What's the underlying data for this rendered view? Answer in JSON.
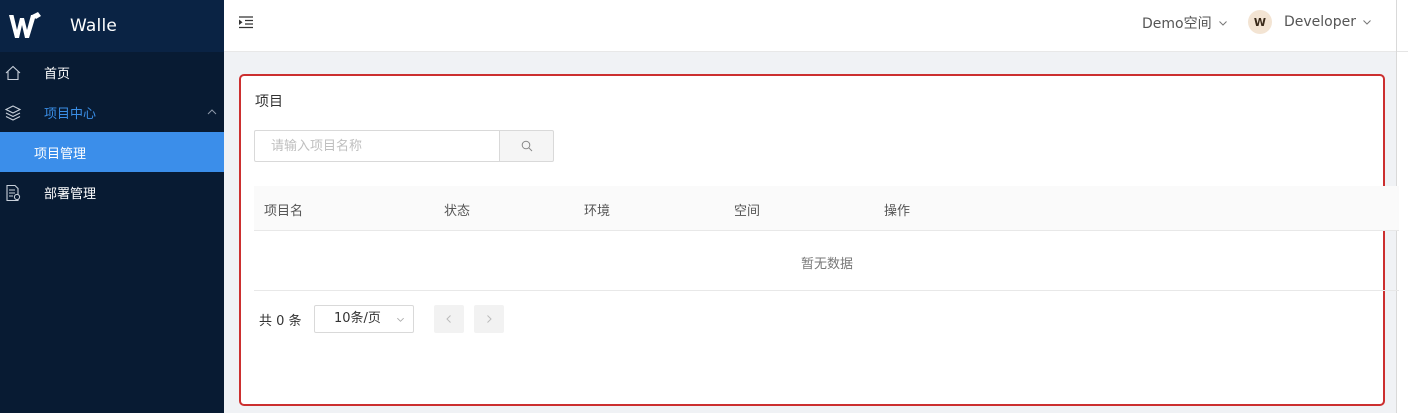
{
  "app": {
    "brand": "Walle"
  },
  "sidebar": {
    "items": [
      {
        "label": "首页",
        "icon": "home-icon"
      },
      {
        "label": "项目中心",
        "icon": "layers-icon",
        "expanded": true
      },
      {
        "label": "项目管理",
        "active": true
      },
      {
        "label": "部署管理",
        "icon": "document-icon"
      }
    ]
  },
  "header": {
    "space": "Demo空间",
    "user": "Developer",
    "avatar_letter": "W"
  },
  "main": {
    "title": "项目",
    "search": {
      "placeholder": "请输入项目名称",
      "value": ""
    },
    "table": {
      "columns": [
        "项目名",
        "状态",
        "环境",
        "空间",
        "操作"
      ],
      "rows": [],
      "empty_text": "暂无数据"
    },
    "pagination": {
      "total_text": "共 0 条",
      "page_size": "10条/页"
    }
  },
  "colors": {
    "sidebar_bg": "#081b33",
    "active_item_bg": "#3b8eea",
    "accent_text": "#3a8ee6",
    "highlight_border": "#cc2f2f"
  }
}
